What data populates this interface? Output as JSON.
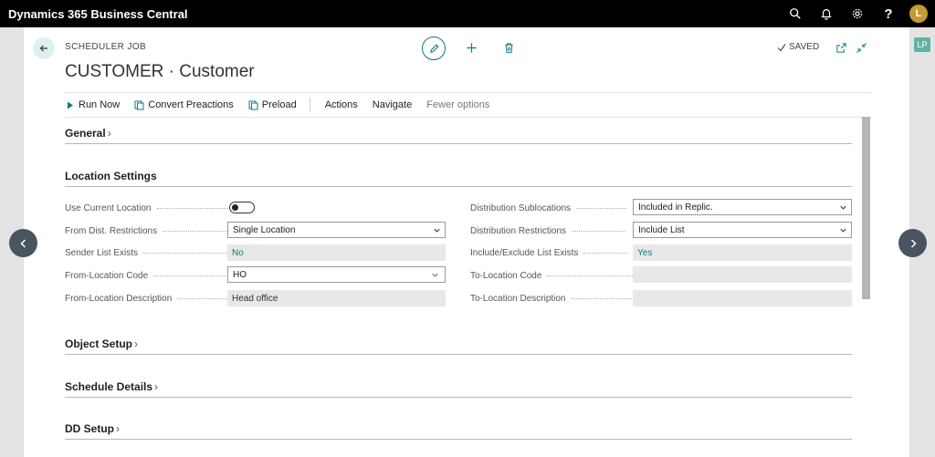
{
  "app": {
    "title": "Dynamics 365 Business Central",
    "user_initial": "L",
    "help_label": "?"
  },
  "side": {
    "right_badge": "LP"
  },
  "page": {
    "caption": "SCHEDULER JOB",
    "title": "CUSTOMER · Customer",
    "status": "SAVED"
  },
  "actions": {
    "run_now": "Run Now",
    "convert_preactions": "Convert Preactions",
    "preload": "Preload",
    "actions": "Actions",
    "navigate": "Navigate",
    "fewer_options": "Fewer options"
  },
  "sections": {
    "general": "General",
    "location_settings": "Location Settings",
    "object_setup": "Object Setup",
    "schedule_details": "Schedule Details",
    "dd_setup": "DD Setup"
  },
  "fields": {
    "use_current_location": {
      "label": "Use Current Location",
      "value": "off"
    },
    "from_dist_restrictions": {
      "label": "From Dist. Restrictions",
      "value": "Single Location"
    },
    "sender_list_exists": {
      "label": "Sender List Exists",
      "value": "No"
    },
    "from_location_code": {
      "label": "From-Location Code",
      "value": "HO"
    },
    "from_location_description": {
      "label": "From-Location Description",
      "value": "Head office"
    },
    "distribution_sublocations": {
      "label": "Distribution Sublocations",
      "value": "Included in Replic."
    },
    "distribution_restrictions": {
      "label": "Distribution Restrictions",
      "value": "Include List"
    },
    "include_exclude_list_exists": {
      "label": "Include/Exclude List Exists",
      "value": "Yes"
    },
    "to_location_code": {
      "label": "To-Location Code",
      "value": ""
    },
    "to_location_description": {
      "label": "To-Location Description",
      "value": ""
    }
  },
  "colors": {
    "accent": "#0b7c83",
    "topbar": "#000000",
    "pager": "#4a5460",
    "avatar": "#c59a2f"
  }
}
